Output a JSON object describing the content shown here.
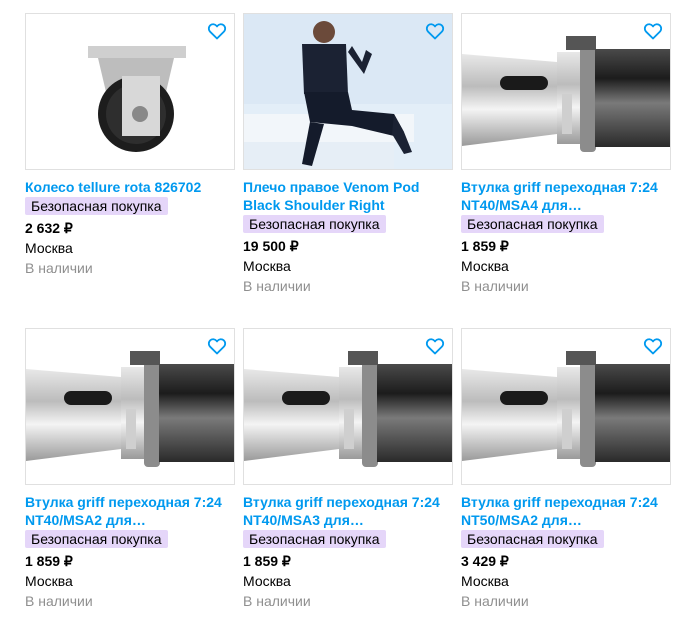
{
  "colors": {
    "title": "#0099ef",
    "badge_bg": "#e5d6f9",
    "muted": "#8f8f8f",
    "favorite": "#0099ef"
  },
  "products": [
    {
      "title": "Колесо tellure rota 826702",
      "badge": "Безопасная покупка",
      "price": "2 632 ₽",
      "city": "Москва",
      "availability": "В наличии",
      "image": "caster-wheel"
    },
    {
      "title": "Плечо правое Venom Pod Black Shoulder Right",
      "badge": "Безопасная покупка",
      "price": "19 500 ₽",
      "city": "Москва",
      "availability": "В наличии",
      "image": "athlete-photo"
    },
    {
      "title": "Втулка griff переходная 7:24 NT40/MSA4 для…",
      "badge": "Безопасная покупка",
      "price": "1 859 ₽",
      "city": "Москва",
      "availability": "В наличии",
      "image": "adapter-sleeve"
    },
    {
      "title": "Втулка griff переходная 7:24 NT40/MSA2 для…",
      "badge": "Безопасная покупка",
      "price": "1 859 ₽",
      "city": "Москва",
      "availability": "В наличии",
      "image": "adapter-sleeve"
    },
    {
      "title": "Втулка griff переходная 7:24 NT40/MSA3 для…",
      "badge": "Безопасная покупка",
      "price": "1 859 ₽",
      "city": "Москва",
      "availability": "В наличии",
      "image": "adapter-sleeve"
    },
    {
      "title": "Втулка griff переходная 7:24 NT50/MSA2 для…",
      "badge": "Безопасная покупка",
      "price": "3 429 ₽",
      "city": "Москва",
      "availability": "В наличии",
      "image": "adapter-sleeve"
    }
  ]
}
